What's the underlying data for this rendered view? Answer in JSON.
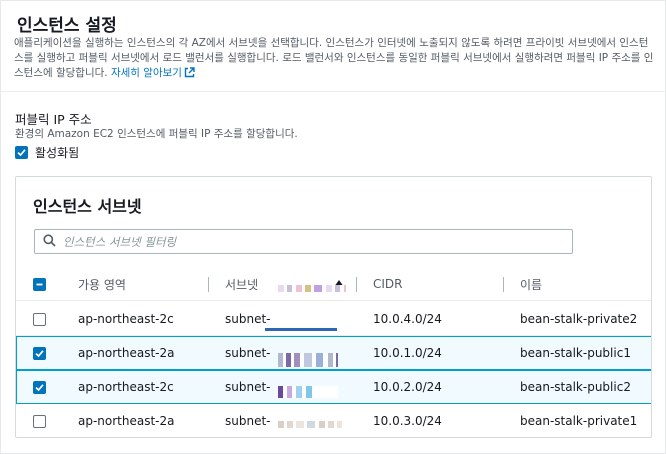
{
  "section": {
    "title": "인스턴스 설정",
    "description": "애플리케이션을 실행하는 인스턴스의 각 AZ에서 서브넷을 선택합니다. 인스턴스가 인터넷에 노출되지 않도록 하려면 프라이빗 서브넷에서 인스턴스를 실행하고 퍼블릭 서브넷에서 로드 밸런서를 실행합니다. 로드 밸런서와 인스턴스를 동일한 퍼블릭 서브넷에서 실행하려면 퍼블릭 IP 주소를 인스턴스에 할당합니다.",
    "learn_more": "자세히 알아보기"
  },
  "public_ip": {
    "label": "퍼블릭 IP 주소",
    "description": "환경의 Amazon EC2 인스턴스에 퍼블릭 IP 주소를 할당합니다.",
    "checkbox_label": "활성화됨",
    "checked": true
  },
  "subnets": {
    "title": "인스턴스 서브넷",
    "search_placeholder": "인스턴스 서브넷 필터링",
    "columns": [
      "가용 영역",
      "서브넷",
      "CIDR",
      "이름"
    ],
    "sort_column": "서브넷",
    "rows": [
      {
        "az": "ap-northeast-2c",
        "subnet": "subnet-",
        "cidr": "10.0.4.0/24",
        "name": "bean-stalk-private2",
        "selected": false
      },
      {
        "az": "ap-northeast-2a",
        "subnet": "subnet-",
        "cidr": "10.0.1.0/24",
        "name": "bean-stalk-public1",
        "selected": true
      },
      {
        "az": "ap-northeast-2c",
        "subnet": "subnet-",
        "cidr": "10.0.2.0/24",
        "name": "bean-stalk-public2",
        "selected": true
      },
      {
        "az": "ap-northeast-2a",
        "subnet": "subnet-",
        "cidr": "10.0.3.0/24",
        "name": "bean-stalk-private1",
        "selected": false
      }
    ]
  },
  "icons": {
    "external_link": "external-link-icon",
    "search": "search-icon",
    "checkbox_checked": "checkmark-icon",
    "checkbox_indeterminate": "minus-icon",
    "sort": "sort-ascending-icon"
  },
  "colors": {
    "accent": "#0073bb",
    "selected_row_bg": "#f1faff",
    "selected_row_border": "#00a1c9"
  }
}
